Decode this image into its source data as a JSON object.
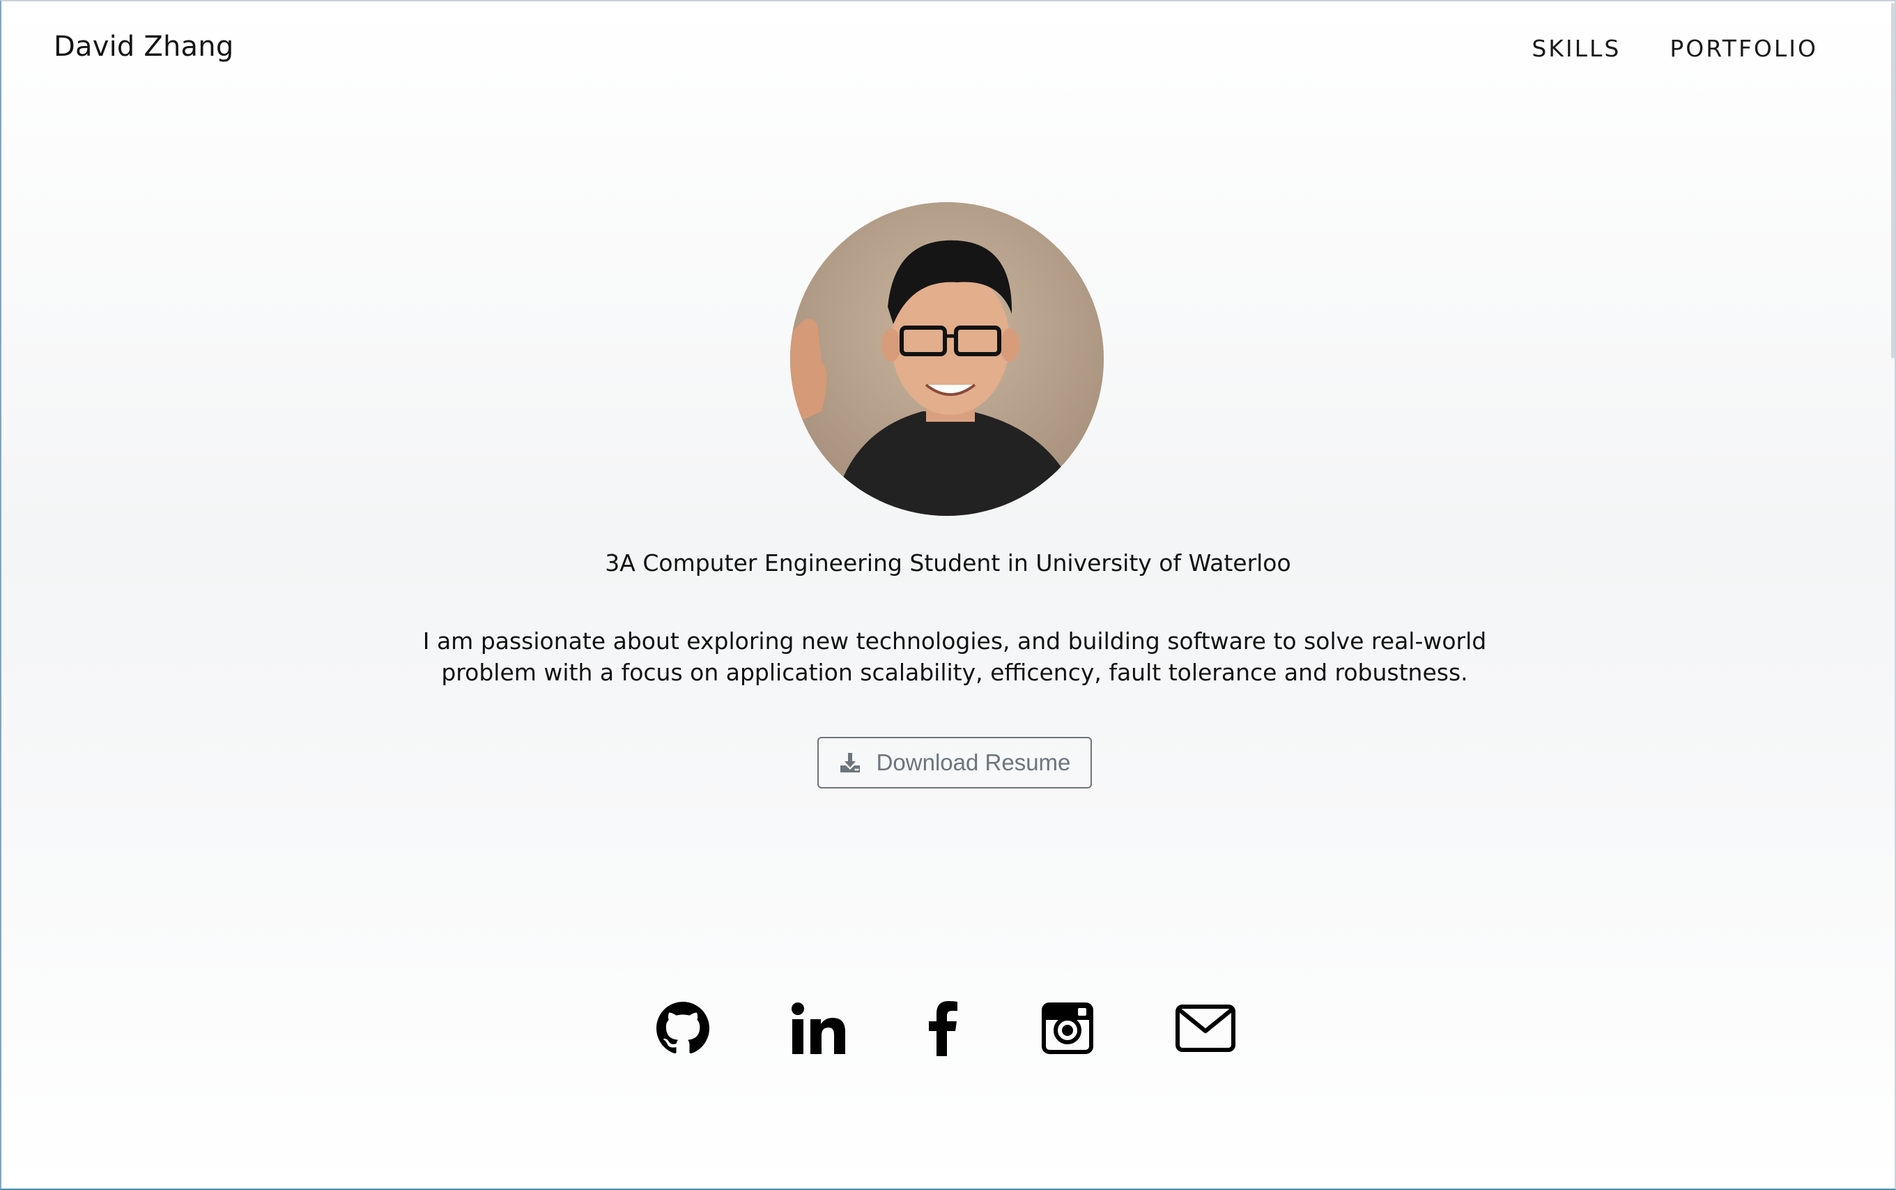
{
  "brand": {
    "name": "David Zhang"
  },
  "nav": {
    "items": [
      {
        "label": "SKILLS"
      },
      {
        "label": "PORTFOLIO"
      }
    ]
  },
  "hero": {
    "tagline": "3A Computer Engineering Student in University of Waterloo",
    "bio": "I am passionate about exploring new technologies, and building software to solve real-world problem with a focus on application scalability, efficency, fault tolerance and robustness.",
    "resume_button": {
      "label": "Download Resume",
      "icon": "download-icon"
    }
  },
  "socials": [
    {
      "icon": "github-icon"
    },
    {
      "icon": "linkedin-icon"
    },
    {
      "icon": "facebook-icon"
    },
    {
      "icon": "instagram-icon"
    },
    {
      "icon": "email-icon"
    }
  ],
  "colors": {
    "text": "#111111",
    "button_outline": "#6c757d",
    "background": "#f5f6f7"
  }
}
